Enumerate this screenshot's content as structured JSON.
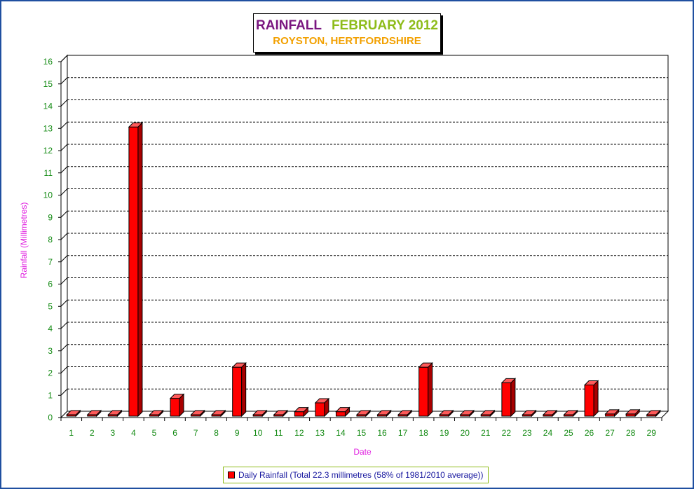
{
  "chart_data": {
    "type": "bar",
    "title": "RAINFALL",
    "title_period": "FEBRUARY 2012",
    "subtitle": "ROYSTON, HERTFORDSHIRE",
    "xlabel": "Date",
    "ylabel": "Rainfall  (Millimetres)",
    "ylim": [
      0,
      16
    ],
    "yticks": [
      0,
      1,
      2,
      3,
      4,
      5,
      6,
      7,
      8,
      9,
      10,
      11,
      12,
      13,
      14,
      15,
      16
    ],
    "grid": true,
    "legend_position": "bottom",
    "categories": [
      "1",
      "2",
      "3",
      "4",
      "5",
      "6",
      "7",
      "8",
      "9",
      "10",
      "11",
      "12",
      "13",
      "14",
      "15",
      "16",
      "17",
      "18",
      "19",
      "20",
      "21",
      "22",
      "23",
      "24",
      "25",
      "26",
      "27",
      "28",
      "29"
    ],
    "series": [
      {
        "name": "Daily Rainfall (Total 22.3 millimetres (58% of 1981/2010 average))",
        "color": "#ff0000",
        "values": [
          0,
          0,
          0,
          13.0,
          0,
          0.8,
          0,
          0,
          2.2,
          0,
          0,
          0.2,
          0.6,
          0.2,
          0,
          0,
          0,
          2.2,
          0,
          0,
          0,
          1.5,
          0,
          0,
          0,
          1.4,
          0.1,
          0.1,
          0
        ]
      }
    ]
  },
  "colors": {
    "frame": "#1f4fa0",
    "bar": "#ff0000",
    "title_main": "#7a1680",
    "title_period": "#8ebc1a",
    "subtitle": "#f2a000",
    "tick_labels": "#138a13",
    "axis_titles": "#e020e0",
    "legend_text": "#1a1aa0"
  }
}
